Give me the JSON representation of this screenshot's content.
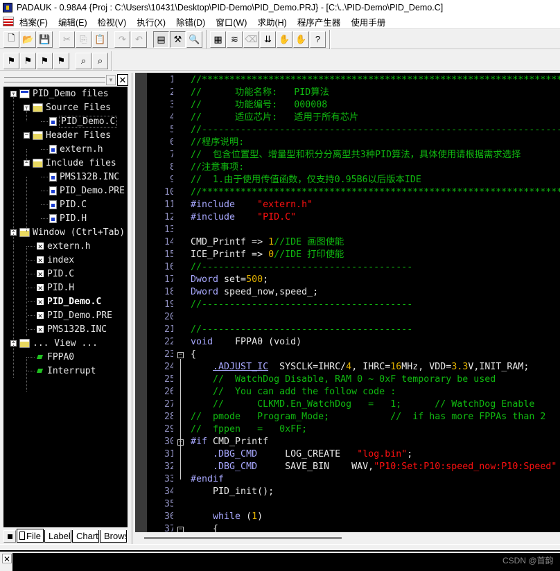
{
  "window": {
    "title": "PADAUK - 0.98A4 {Proj : C:\\Users\\10431\\Desktop\\PID-Demo\\PID_Demo.PRJ} - [C:\\..\\PID-Demo\\PID_Demo.C]"
  },
  "menu": [
    "档案(F)",
    "编辑(E)",
    "检视(V)",
    "执行(X)",
    "除错(D)",
    "窗口(W)",
    "求助(H)",
    "程序产生器",
    "使用手册"
  ],
  "toolbar1": [
    {
      "icon": "new-file-icon",
      "glyph": "🗋"
    },
    {
      "icon": "open-folder-icon",
      "glyph": "📂"
    },
    {
      "icon": "save-icon",
      "glyph": "💾"
    },
    {
      "sep": true
    },
    {
      "icon": "cut-icon",
      "glyph": "✂",
      "disabled": true
    },
    {
      "icon": "copy-icon",
      "glyph": "⎘",
      "disabled": true
    },
    {
      "icon": "paste-icon",
      "glyph": "📋",
      "disabled": true
    },
    {
      "sep": true
    },
    {
      "icon": "redo-icon",
      "glyph": "↷",
      "disabled": true
    },
    {
      "icon": "undo-icon",
      "glyph": "↶",
      "disabled": true
    },
    {
      "sep": true
    },
    {
      "icon": "workspace-icon",
      "glyph": "▤",
      "pressed": true
    },
    {
      "icon": "build-icon",
      "glyph": "⚒",
      "pressed": true
    },
    {
      "icon": "find-in-files-icon",
      "glyph": "🔍"
    },
    {
      "end": true
    },
    {
      "icon": "download-icon",
      "glyph": "▦"
    },
    {
      "icon": "stack-icon",
      "glyph": "≋"
    },
    {
      "icon": "erase-icon",
      "glyph": "⌫",
      "disabled": true
    },
    {
      "icon": "sort-icon",
      "glyph": "⇊"
    },
    {
      "icon": "hand-stop-icon",
      "glyph": "✋"
    },
    {
      "icon": "hand-disabled-icon",
      "glyph": "✋",
      "disabled": true
    },
    {
      "icon": "help-icon",
      "glyph": "?"
    },
    {
      "end": true
    }
  ],
  "toolbar2": [
    {
      "icon": "bookmark-toggle-icon",
      "glyph": "⚑"
    },
    {
      "icon": "bookmark-next-icon",
      "glyph": "⚑"
    },
    {
      "icon": "bookmark-prev-icon",
      "glyph": "⚑"
    },
    {
      "icon": "bookmark-clear-icon",
      "glyph": "⚑"
    },
    {
      "sep": true
    },
    {
      "icon": "binoculars-find-icon",
      "glyph": "⌕"
    },
    {
      "icon": "find-replace-icon",
      "glyph": "⌕"
    },
    {
      "end": true
    }
  ],
  "tree": [
    {
      "label": "PID_Demo files",
      "icon": "proj",
      "level": 0,
      "expander": true
    },
    {
      "label": "Source Files",
      "icon": "folder",
      "level": 1,
      "expander": true
    },
    {
      "label": "PID_Demo.C",
      "icon": "file",
      "level": 2,
      "selected": true
    },
    {
      "label": "Header Files",
      "icon": "folder",
      "level": 1,
      "expander": true
    },
    {
      "label": "extern.h",
      "icon": "file",
      "level": 2
    },
    {
      "label": "Include files",
      "icon": "folder",
      "level": 1,
      "expander": true
    },
    {
      "label": "PMS132B.INC",
      "icon": "file",
      "level": 2
    },
    {
      "label": "PID_Demo.PRE",
      "icon": "file",
      "level": 2
    },
    {
      "label": "PID.C",
      "icon": "file",
      "level": 2
    },
    {
      "label": "PID.H",
      "icon": "file",
      "level": 2
    },
    {
      "label": "Window (Ctrl+Tab)",
      "icon": "folder",
      "level": 0,
      "expander": true
    },
    {
      "label": "extern.h",
      "icon": "xbox",
      "level": 1
    },
    {
      "label": "index",
      "icon": "xbox",
      "level": 1
    },
    {
      "label": "PID.C",
      "icon": "xbox",
      "level": 1
    },
    {
      "label": "PID.H",
      "icon": "xbox",
      "level": 1
    },
    {
      "label": "PID_Demo.C",
      "icon": "xbox",
      "level": 1,
      "bold": true
    },
    {
      "label": "PID_Demo.PRE",
      "icon": "xbox",
      "level": 1
    },
    {
      "label": "PMS132B.INC",
      "icon": "xbox",
      "level": 1
    },
    {
      "label": "... View ...",
      "icon": "folder",
      "level": 0,
      "expander": true
    },
    {
      "label": "FPPA0",
      "icon": "fn",
      "level": 1
    },
    {
      "label": "Interrupt",
      "icon": "fn",
      "level": 1
    }
  ],
  "panel_tabs": [
    {
      "label": "File",
      "color": "#ffffff",
      "active": true
    },
    {
      "label": "Label",
      "color": "#0000ff"
    },
    {
      "label": "Chart",
      "color": "#ff0000"
    },
    {
      "label": "Browse",
      "color": "#00d000"
    }
  ],
  "colors": {
    "comment": "#10b810",
    "keyword": "#a8a8ff",
    "string": "#ff1010",
    "number": "#e0b000",
    "text": "#e8e8e8"
  },
  "code": [
    [
      [
        "//**************************************************************************",
        "c"
      ]
    ],
    [
      [
        "//      功能名称:   PID算法",
        "c"
      ]
    ],
    [
      [
        "//      功能编号:   000008",
        "c"
      ]
    ],
    [
      [
        "//      适应芯片:   适用于所有芯片",
        "c"
      ]
    ],
    [
      [
        "//--------------------------------------------------------------------------",
        "c"
      ]
    ],
    [
      [
        "//程序说明:",
        "c"
      ]
    ],
    [
      [
        "//  包含位置型、增量型和积分分离型共3种PID算法，具体使用请根据需求选择",
        "c"
      ]
    ],
    [
      [
        "//注意事项:",
        "c"
      ]
    ],
    [
      [
        "//  1.由于使用传值函数，仅支持0.95B6以后版本IDE",
        "c"
      ]
    ],
    [
      [
        "//**************************************************************************",
        "c"
      ]
    ],
    [
      [
        "#include",
        "k"
      ],
      [
        "    ",
        "t"
      ],
      [
        "\"extern.h\"",
        "s"
      ]
    ],
    [
      [
        "#include",
        "k"
      ],
      [
        "    ",
        "t"
      ],
      [
        "\"PID.C\"",
        "s"
      ]
    ],
    [],
    [
      [
        "CMD_Printf => ",
        "t"
      ],
      [
        "1",
        "n"
      ],
      [
        "//IDE 画图使能",
        "c"
      ]
    ],
    [
      [
        "ICE_Printf => ",
        "t"
      ],
      [
        "0",
        "n"
      ],
      [
        "//IDE 打印使能",
        "c"
      ]
    ],
    [
      [
        "//--------------------------------------",
        "c"
      ]
    ],
    [
      [
        "Dword",
        "k"
      ],
      [
        " set=",
        "t"
      ],
      [
        "500",
        "n"
      ],
      [
        ";",
        "t"
      ]
    ],
    [
      [
        "Dword",
        "k"
      ],
      [
        " speed_now,speed_;",
        "t"
      ]
    ],
    [
      [
        "//--------------------------------------",
        "c"
      ]
    ],
    [],
    [
      [
        "//--------------------------------------",
        "c"
      ]
    ],
    [
      [
        "void",
        "k"
      ],
      [
        "    FPPA0 (void)",
        "t"
      ]
    ],
    [
      [
        "{",
        "t"
      ]
    ],
    [
      [
        "    ",
        "t"
      ],
      [
        ".ADJUST_IC",
        "u"
      ],
      [
        "  SYSCLK=IHRC/",
        "t"
      ],
      [
        "4",
        "n"
      ],
      [
        ", IHRC=",
        "t"
      ],
      [
        "16",
        "n"
      ],
      [
        "MHz, VDD=",
        "t"
      ],
      [
        "3.3",
        "n"
      ],
      [
        "V,INIT_RAM;",
        "t"
      ]
    ],
    [
      [
        "    //  WatchDog Disable, RAM 0 ~ 0xF temporary be used",
        "c"
      ]
    ],
    [
      [
        "    //  You can add the follow code :",
        "c"
      ]
    ],
    [
      [
        "    //      CLKMD.En_WatchDog   =   1;      // WatchDog Enable",
        "c"
      ]
    ],
    [
      [
        "//  pmode   Program_Mode;           //  if has more FPPAs than 2",
        "c"
      ]
    ],
    [
      [
        "//  fppen   =   0xFF;",
        "c"
      ]
    ],
    [
      [
        "#if",
        "k"
      ],
      [
        " CMD_Printf",
        "t"
      ]
    ],
    [
      [
        "    ",
        "t"
      ],
      [
        ".DBG_CMD",
        "k"
      ],
      [
        "     LOG_CREATE   ",
        "t"
      ],
      [
        "\"log.bin\"",
        "s"
      ],
      [
        ";",
        "t"
      ]
    ],
    [
      [
        "    ",
        "t"
      ],
      [
        ".DBG_CMD",
        "k"
      ],
      [
        "     SAVE_BIN    WAV,",
        "t"
      ],
      [
        "\"P10:Set:P10:speed_now:P10:Speed\"",
        "s"
      ]
    ],
    [
      [
        "#endif",
        "k"
      ]
    ],
    [
      [
        "    PID_init();",
        "t"
      ]
    ],
    [],
    [
      [
        "    ",
        "t"
      ],
      [
        "while",
        "k"
      ],
      [
        " (",
        "t"
      ],
      [
        "1",
        "n"
      ],
      [
        ")",
        "t"
      ]
    ],
    [
      [
        "    {",
        "t"
      ]
    ]
  ],
  "folds": {
    "23": "open",
    "30": "open",
    "37": "open"
  },
  "watermark": "CSDN @首韵"
}
